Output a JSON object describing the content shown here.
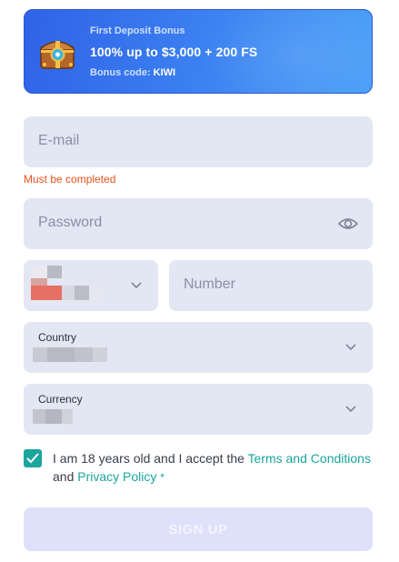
{
  "banner": {
    "title": "First Deposit Bonus",
    "headline": "100% up to $3,000 + 200 FS",
    "code_prefix": "Bonus code: ",
    "code": "KIWI"
  },
  "form": {
    "email_placeholder": "E-mail",
    "email_error": "Must be completed",
    "password_placeholder": "Password",
    "number_placeholder": "Number",
    "country_label": "Country",
    "currency_label": "Currency"
  },
  "terms": {
    "text_1": "I am 18 years old and I accept the ",
    "terms_link": "Terms and Conditions",
    "text_2": "and ",
    "privacy_link": "Privacy Policy",
    "required_mark": "*",
    "checked": true
  },
  "signup_label": "SIGN UP",
  "colors": {
    "accent": "#1aa59d",
    "error": "#e2541b",
    "field_bg": "#e3e6f3",
    "banner_blue": "#2f63e6",
    "button_disabled": "#dfe1fb"
  },
  "icons": {
    "chest": "treasure-chest-icon",
    "eye": "eye-icon",
    "chevron": "chevron-down-icon",
    "check": "checkmark-icon"
  }
}
